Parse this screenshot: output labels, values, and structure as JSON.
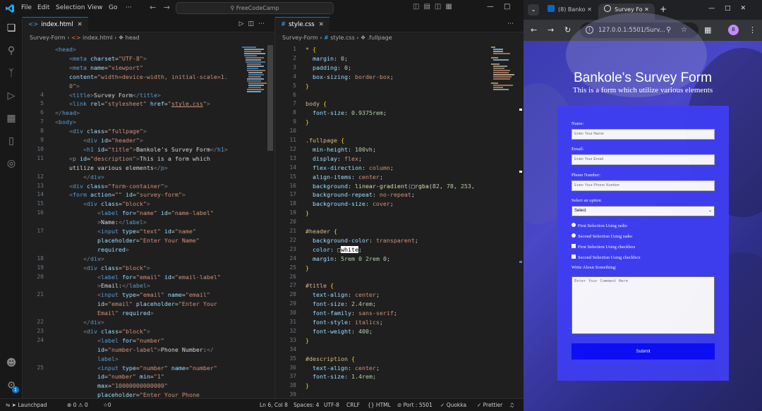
{
  "vscode": {
    "menu": [
      "File",
      "Edit",
      "Selection",
      "View",
      "Go",
      "···"
    ],
    "command_center": "FreeCodeCamp",
    "editor1": {
      "tab_label": "index.html",
      "breadcrumb": [
        "Survey-Form",
        "index.html",
        "head"
      ],
      "lines": [
        {
          "n": "",
          "html": "<span class='p'>&lt;</span><span class='t'>head</span><span class='p'>&gt;</span>"
        },
        {
          "n": "",
          "html": "    <span class='p'>&lt;</span><span class='t'>meta</span> <span class='a'>charset</span>=<span class='s'>\"UTF-8\"</span><span class='p'>&gt;</span>"
        },
        {
          "n": "",
          "html": "    <span class='p'>&lt;</span><span class='t'>meta</span> <span class='a'>name</span>=<span class='s'>\"viewport\"</span>"
        },
        {
          "n": "",
          "html": "    <span class='a'>content</span>=<span class='s'>\"width=device-width, initial-scale=1.</span>"
        },
        {
          "n": "",
          "html": "    <span class='s'>0\"</span><span class='p'>&gt;</span>"
        },
        {
          "n": "4",
          "html": "    <span class='p'>&lt;</span><span class='t'>title</span><span class='p'>&gt;</span>Survey Form<span class='p'>&lt;/</span><span class='t'>title</span><span class='p'>&gt;</span>"
        },
        {
          "n": "5",
          "html": "    <span class='p'>&lt;</span><span class='t'>link</span> <span class='a'>rel</span>=<span class='s'>\"stylesheet\"</span> <span class='a'>href</span>=<span class='s'>\"<u>style.css</u>\"</span><span class='p'>&gt;</span>"
        },
        {
          "n": "6",
          "html": "<span class='p'>&lt;/</span><span class='t'>head</span><span class='p'>&gt;</span>"
        },
        {
          "n": "7",
          "html": "<span class='p'>&lt;</span><span class='t'>body</span><span class='p'>&gt;</span>"
        },
        {
          "n": "8",
          "html": "    <span class='p'>&lt;</span><span class='t'>div</span> <span class='a'>class</span>=<span class='s'>\"fullpage\"</span><span class='p'>&gt;</span>"
        },
        {
          "n": "9",
          "html": "        <span class='p'>&lt;</span><span class='t'>div</span> <span class='a'>id</span>=<span class='s'>\"header\"</span><span class='p'>&gt;</span>"
        },
        {
          "n": "10",
          "html": "        <span class='p'>&lt;</span><span class='t'>h1</span> <span class='a'>id</span>=<span class='s'>\"title\"</span><span class='p'>&gt;</span>Bankole's Survey Form<span class='p'>&lt;/</span><span class='t'>h1</span><span class='p'>&gt;</span>"
        },
        {
          "n": "11",
          "html": "    <span class='p'>&lt;</span><span class='t'>p</span> <span class='a'>id</span>=<span class='s'>\"description\"</span><span class='p'>&gt;</span>This is a form which"
        },
        {
          "n": "",
          "html": "    utilize various elements<span class='p'>&lt;/</span><span class='t'>p</span><span class='p'>&gt;</span>"
        },
        {
          "n": "12",
          "html": "        <span class='p'>&lt;/</span><span class='t'>div</span><span class='p'>&gt;</span>"
        },
        {
          "n": "13",
          "html": "    <span class='p'>&lt;</span><span class='t'>div</span> <span class='a'>class</span>=<span class='s'>\"form-container\"</span><span class='p'>&gt;</span>"
        },
        {
          "n": "14",
          "html": "    <span class='p'>&lt;</span><span class='t'>form</span> <span class='a'>action</span>=<span class='s'>\"\"</span> <span class='a'>id</span>=<span class='s'>\"survey-form\"</span><span class='p'>&gt;</span>"
        },
        {
          "n": "15",
          "html": "        <span class='p'>&lt;</span><span class='t'>div</span> <span class='a'>class</span>=<span class='s'>\"block\"</span><span class='p'>&gt;</span>"
        },
        {
          "n": "16",
          "html": "            <span class='p'>&lt;</span><span class='t'>label</span> <span class='a'>for</span>=<span class='s'>\"name\"</span> <span class='a'>id</span>=<span class='s'>\"name-label\"</span>"
        },
        {
          "n": "",
          "html": "            <span class='p'>&gt;</span>Name:<span class='p'>&lt;/</span><span class='t'>label</span><span class='p'>&gt;</span>"
        },
        {
          "n": "17",
          "html": "            <span class='p'>&lt;</span><span class='t'>input</span> <span class='a'>type</span>=<span class='s'>\"text\"</span> <span class='a'>id</span>=<span class='s'>\"name\"</span>"
        },
        {
          "n": "",
          "html": "            <span class='a'>placeholder</span>=<span class='s'>\"Enter Your Name\"</span>"
        },
        {
          "n": "",
          "html": "            <span class='a'>required</span><span class='p'>&gt;</span>"
        },
        {
          "n": "18",
          "html": "        <span class='p'>&lt;/</span><span class='t'>div</span><span class='p'>&gt;</span>"
        },
        {
          "n": "19",
          "html": "        <span class='p'>&lt;</span><span class='t'>div</span> <span class='a'>class</span>=<span class='s'>\"block\"</span><span class='p'>&gt;</span>"
        },
        {
          "n": "20",
          "html": "            <span class='p'>&lt;</span><span class='t'>label</span> <span class='a'>for</span>=<span class='s'>\"email\"</span> <span class='a'>id</span>=<span class='s'>\"email-label\"</span>"
        },
        {
          "n": "",
          "html": "            <span class='p'>&gt;</span>Email:<span class='p'>&lt;/</span><span class='t'>label</span><span class='p'>&gt;</span>"
        },
        {
          "n": "21",
          "html": "            <span class='p'>&lt;</span><span class='t'>input</span> <span class='a'>type</span>=<span class='s'>\"email\"</span> <span class='a'>name</span>=<span class='s'>\"email\"</span>"
        },
        {
          "n": "",
          "html": "            <span class='a'>id</span>=<span class='s'>\"email\"</span> <span class='a'>placeholder</span>=<span class='s'>\"Enter Your</span>"
        },
        {
          "n": "",
          "html": "            <span class='s'>Email\"</span> <span class='a'>required</span><span class='p'>&gt;</span>"
        },
        {
          "n": "22",
          "html": "        <span class='p'>&lt;/</span><span class='t'>div</span><span class='p'>&gt;</span>"
        },
        {
          "n": "23",
          "html": "        <span class='p'>&lt;</span><span class='t'>div</span> <span class='a'>class</span>=<span class='s'>\"block\"</span><span class='p'>&gt;</span>"
        },
        {
          "n": "24",
          "html": "            <span class='p'>&lt;</span><span class='t'>label</span> <span class='a'>for</span>=<span class='s'>\"number\"</span>"
        },
        {
          "n": "",
          "html": "            <span class='a'>id</span>=<span class='s'>\"number-label\"</span><span class='p'>&gt;</span>Phone Number:<span class='p'>&lt;/</span>"
        },
        {
          "n": "",
          "html": "            <span class='t'>label</span><span class='p'>&gt;</span>"
        },
        {
          "n": "25",
          "html": "            <span class='p'>&lt;</span><span class='t'>input</span> <span class='a'>type</span>=<span class='s'>\"number\"</span> <span class='a'>name</span>=<span class='s'>\"number\"</span>"
        },
        {
          "n": "",
          "html": "            <span class='a'>id</span>=<span class='s'>\"number\"</span> <span class='a'>min</span>=<span class='s'>\"1\"</span>"
        },
        {
          "n": "",
          "html": "            <span class='a'>max</span>=<span class='s'>\"10000000000000\"</span>"
        },
        {
          "n": "",
          "html": "            <span class='a'>placeholder</span>=<span class='s'>\"Enter Your Phone</span>"
        }
      ]
    },
    "editor2": {
      "tab_label": "style.css",
      "breadcrumb": [
        "Survey-Form",
        "style.css",
        ".fullpage"
      ],
      "lines": [
        {
          "n": "1",
          "html": "<span class='sel'>*</span> <span class='br'>{</span>"
        },
        {
          "n": "2",
          "html": "  <span class='pr'>margin</span>: <span class='n'>0</span>;"
        },
        {
          "n": "3",
          "html": "  <span class='pr'>padding</span>: <span class='n'>0</span>;"
        },
        {
          "n": "4",
          "html": "  <span class='pr'>box-sizing</span>: <span class='v'>border-box</span>;"
        },
        {
          "n": "5",
          "html": "<span class='br'>}</span>"
        },
        {
          "n": "6",
          "html": ""
        },
        {
          "n": "7",
          "html": "<span class='sel'>body</span> <span class='br'>{</span>"
        },
        {
          "n": "8",
          "html": "  <span class='pr'>font-size</span>: <span class='n'>0.9375rem</span>;"
        },
        {
          "n": "9",
          "html": "<span class='br'>}</span>"
        },
        {
          "n": "10",
          "html": ""
        },
        {
          "n": "11",
          "html": "<span class='sel'>.fullpage</span> <span class='br'>{</span>"
        },
        {
          "n": "12",
          "html": "  <span class='pr'>min-height</span>: <span class='n'>100vh</span>;"
        },
        {
          "n": "13",
          "html": "  <span class='pr'>display</span>: <span class='v'>flex</span>;"
        },
        {
          "n": "14",
          "html": "  <span class='pr'>flex-direction</span>: <span class='v'>column</span>;"
        },
        {
          "n": "15",
          "html": "  <span class='pr'>align-items</span>: <span class='v'>center</span>;"
        },
        {
          "n": "16",
          "html": "  <span class='pr'>background</span>: <span class='f'>linear-gradient</span><span class='br2'>(</span>&#9633;<span class='f'>rgba</span>(<span class='n'>82</span>, <span class='n'>78</span>, <span class='n'>253</span>,"
        },
        {
          "n": "17",
          "html": "  <span class='pr'>background-repeat</span>: <span class='v'>no-repeat</span>;"
        },
        {
          "n": "18",
          "html": "  <span class='pr'>background-size</span>: <span class='v'>cover</span>;"
        },
        {
          "n": "19",
          "html": "<span class='br'>}</span>"
        },
        {
          "n": "20",
          "html": ""
        },
        {
          "n": "21",
          "html": "<span class='sel'>#header</span> <span class='br'>{</span>"
        },
        {
          "n": "22",
          "html": "  <span class='pr'>background-color</span>: <span class='v'>transparent</span>;"
        },
        {
          "n": "23",
          "html": "  <span class='pr'>color</span>: &#9633;<span style='background:#fff;color:#000'>white</span>;"
        },
        {
          "n": "24",
          "html": "  <span class='pr'>margin</span>: <span class='n'>5rem</span> <span class='n'>0</span> <span class='n'>2rem</span> <span class='n'>0</span>;"
        },
        {
          "n": "25",
          "html": "<span class='br'>}</span>"
        },
        {
          "n": "26",
          "html": ""
        },
        {
          "n": "27",
          "html": "<span class='sel'>#title</span> <span class='br'>{</span>"
        },
        {
          "n": "28",
          "html": "  <span class='pr'>text-align</span>: <span class='v'>center</span>;"
        },
        {
          "n": "29",
          "html": "  <span class='pr'>font-size</span>: <span class='n'>2.4rem</span>;"
        },
        {
          "n": "30",
          "html": "  <span class='pr'>font-family</span>: <span class='v'>sans-serif</span>;"
        },
        {
          "n": "31",
          "html": "  <span class='pr'>font-style</span>: <span class='v'>italics</span>;"
        },
        {
          "n": "32",
          "html": "  <span class='pr'>font-weight</span>: <span class='n'>400</span>;"
        },
        {
          "n": "33",
          "html": "<span class='br'>}</span>"
        },
        {
          "n": "34",
          "html": ""
        },
        {
          "n": "35",
          "html": "<span class='sel'>#description</span> <span class='br'>{</span>"
        },
        {
          "n": "36",
          "html": "  <span class='pr'>text-align</span>: <span class='v'>center</span>;"
        },
        {
          "n": "37",
          "html": "  <span class='pr'>font-size</span>: <span class='n'>1.4rem</span>;"
        },
        {
          "n": "38",
          "html": "<span class='br'>}</span>"
        },
        {
          "n": "39",
          "html": ""
        }
      ]
    },
    "status": {
      "remote": "Launchpad",
      "problems": "⊗ 0 ⚠ 0",
      "ports": "☆0",
      "position": "Ln 6, Col 8",
      "spaces": "Spaces: 4",
      "encoding": "UTF-8",
      "eol": "CRLF",
      "language": "{} HTML",
      "port": "⊘ Port : 5501",
      "quokka": "Quokka",
      "prettier": "✓ Prettier"
    },
    "badge_count": "1"
  },
  "browser": {
    "tab1": "(8) Banko",
    "tab2": "Survey Fo",
    "url": "127.0.0.1:5501/Surv...",
    "profile": "B"
  },
  "survey": {
    "title": "Bankole's Survey Form",
    "description": "This is a form which utilize various elements",
    "name_label": "Name:",
    "name_placeholder": "Enter Your Name",
    "email_label": "Email:",
    "email_placeholder": "Enter Your Email",
    "phone_label": "Phone Number:",
    "phone_placeholder": "Enter Your Phone Number",
    "select_label": "Select an option",
    "select_value": "Select",
    "radio1": "First Selection Using radio",
    "radio2": "Second Selection Using radio",
    "check1": "First Selection Using checkbox",
    "check2": "Second Selection Using checkbox",
    "textarea_label": "Write About Something:",
    "textarea_placeholder": "Enter Your Comment Here",
    "submit": "Submit"
  },
  "colors": {
    "accent": "#0078d4",
    "form_bg": "#3f3ef2",
    "submit_bg": "#0d0dfa"
  }
}
